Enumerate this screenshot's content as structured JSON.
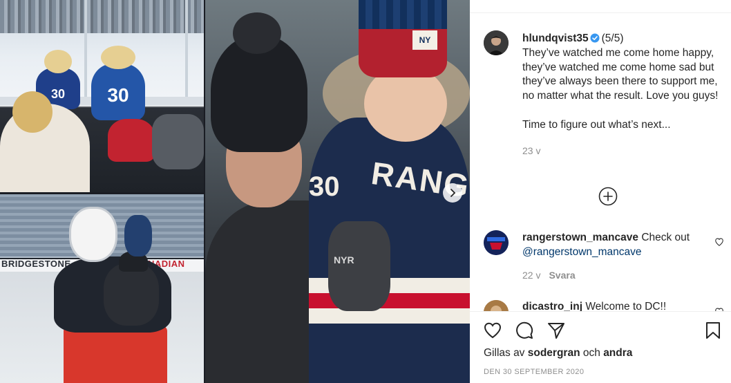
{
  "post": {
    "author": {
      "username": "hlundqvist35",
      "verified": true,
      "avatar_icon": "profile-photo"
    },
    "slide_counter": "(5/5)",
    "caption": "They’ve watched me come home happy, they’ve watched me come home sad but they’ve always been there to support me, no matter what the result. Love you guys!\n\nTime to figure out what’s next...",
    "time_ago": "23 v",
    "liked_by_prefix": "Gillas av",
    "liked_by_user": "sodergran",
    "liked_by_conjunction": "och",
    "liked_by_others": "andra",
    "date": "DEN 30 SEPTEMBER 2020"
  },
  "media": {
    "rink_boards_text": "BRIDGESTONE",
    "rink_boards_text_2": "NADIAN",
    "kid_jersey_numbers": [
      "30",
      "30"
    ],
    "hat_patch": "NY",
    "jersey_word": "RANGE",
    "jersey_number": "30",
    "glove_text": "NYR",
    "next_icon": "chevron-right-icon"
  },
  "comments": [
    {
      "username": "rangerstown_mancave",
      "text": "Check out",
      "mention": "@rangerstown_mancave",
      "time_ago": "22 v",
      "reply_label": "Svara"
    },
    {
      "username": "dicastro_inj",
      "text": "Welcome to DC!!"
    }
  ],
  "icons": {
    "load_more": "plus-circle-icon",
    "like": "heart-icon",
    "comment": "comment-icon",
    "share": "paper-plane-icon",
    "save": "bookmark-icon"
  },
  "colors": {
    "text": "#262626",
    "secondary": "#8e8e8e",
    "verified": "#3897f0",
    "link": "#00376b",
    "rangers_blue": "#1c2c4d",
    "rangers_red": "#c8102e"
  }
}
